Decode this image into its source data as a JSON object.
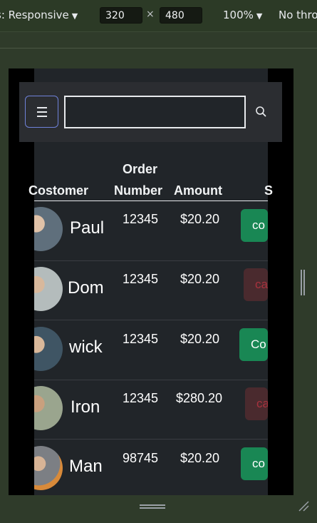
{
  "devtools": {
    "device_label": "s: Responsive",
    "width_value": "320",
    "times_symbol": "×",
    "height_value": "480",
    "zoom_label": "100%",
    "throttle_label": "No thro"
  },
  "header": {
    "search_placeholder": ""
  },
  "table": {
    "headers": {
      "customer": "Costomer",
      "order_line1": "Order",
      "order_line2": "Number",
      "amount": "Amount",
      "status_partial": "S"
    },
    "rows": [
      {
        "name": "Paul",
        "order": "12345",
        "amount": "$20.20",
        "status": "co",
        "status_type": "complete",
        "avatar_color": "#6b7a86"
      },
      {
        "name": "Dom",
        "order": "12345",
        "amount": "$20.20",
        "status": "ca",
        "status_type": "cancelled",
        "avatar_color": "#9aa7a8"
      },
      {
        "name": "wick",
        "order": "12345",
        "amount": "$20.20",
        "status": "Co",
        "status_type": "complete",
        "avatar_color": "#4e6472"
      },
      {
        "name": "Iron",
        "order": "12345",
        "amount": "$280.20",
        "status": "ca",
        "status_type": "cancelled",
        "avatar_color": "#8e9a86"
      },
      {
        "name": "Man",
        "order": "98745",
        "amount": "$20.20",
        "status": "co",
        "status_type": "complete",
        "avatar_color": "#c98a4a"
      }
    ]
  },
  "colors": {
    "page_bg": "#212529",
    "complete": "#198754",
    "cancelled_bg": "#4a2a2e",
    "cancelled_text": "#a8323e",
    "toggle_border": "#6f82d9"
  }
}
